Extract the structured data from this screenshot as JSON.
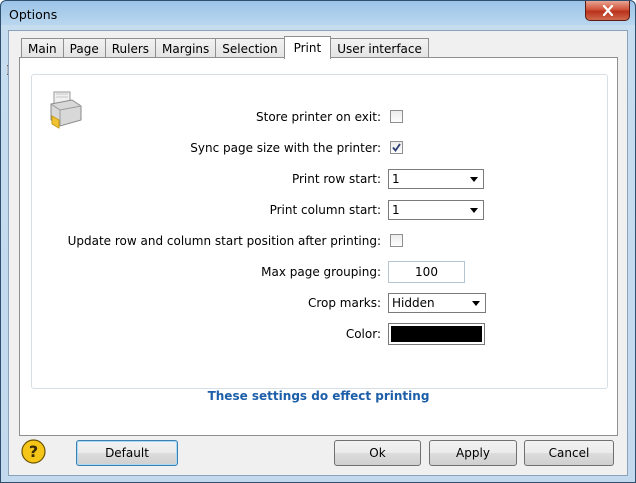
{
  "window": {
    "title": "Options"
  },
  "tabs": [
    "Main",
    "Page",
    "Rulers",
    "Margins",
    "Selection",
    "Print",
    "User interface"
  ],
  "active_tab": "Print",
  "print": {
    "store_printer_label": "Store printer on exit:",
    "store_printer_checked": false,
    "sync_page_label": "Sync page size with the printer:",
    "sync_page_checked": true,
    "row_start_label": "Print row start:",
    "row_start_value": "1",
    "column_start_label": "Print column start:",
    "column_start_value": "1",
    "update_start_label": "Update row and column start position after printing:",
    "update_start_checked": false,
    "max_grouping_label": "Max page grouping:",
    "max_grouping_value": "100",
    "crop_marks_label": "Crop marks:",
    "crop_marks_value": "Hidden",
    "color_label": "Color:",
    "color_value": "#000000",
    "note": "These settings do effect printing"
  },
  "buttons": {
    "default": "Default",
    "ok": "Ok",
    "apply": "Apply",
    "cancel": "Cancel"
  },
  "icons": {
    "printer": "printer-icon",
    "help": "help-icon",
    "close": "close-icon"
  }
}
